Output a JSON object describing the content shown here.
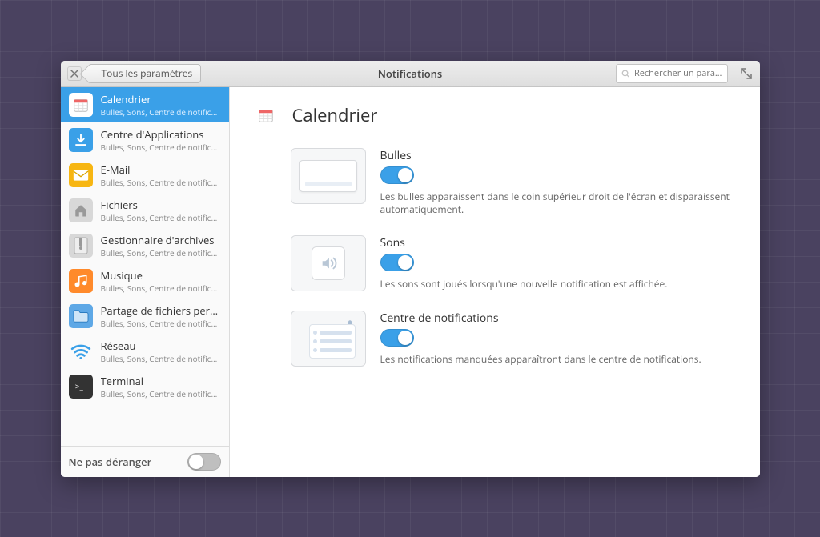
{
  "titlebar": {
    "breadcrumb": "Tous les paramètres",
    "title": "Notifications",
    "search_placeholder": "Rechercher un para…"
  },
  "sidebar": {
    "items": [
      {
        "title": "Calendrier",
        "sub": "Bulles, Sons, Centre de notifications",
        "icon": "calendar",
        "color": "#ffffff",
        "selected": true
      },
      {
        "title": "Centre d'Applications",
        "sub": "Bulles, Sons, Centre de notifications",
        "icon": "download",
        "color": "#3aa0e8"
      },
      {
        "title": "E-Mail",
        "sub": "Bulles, Sons, Centre de notifications",
        "icon": "mail",
        "color": "#f7b612"
      },
      {
        "title": "Fichiers",
        "sub": "Bulles, Sons, Centre de notifications",
        "icon": "home",
        "color": "#d8d8d8"
      },
      {
        "title": "Gestionnaire d'archives",
        "sub": "Bulles, Sons, Centre de notifications",
        "icon": "zip",
        "color": "#d8d8d8"
      },
      {
        "title": "Musique",
        "sub": "Bulles, Sons, Centre de notifications",
        "icon": "music",
        "color": "#ff8a2b"
      },
      {
        "title": "Partage de fichiers perso…",
        "sub": "Bulles, Sons, Centre de notifications",
        "icon": "folder",
        "color": "#5ea8e6"
      },
      {
        "title": "Réseau",
        "sub": "Bulles, Sons, Centre de notifications",
        "icon": "wifi",
        "color": "#3aa0e8"
      },
      {
        "title": "Terminal",
        "sub": "Bulles, Sons, Centre de notifications",
        "icon": "terminal",
        "color": "#333333"
      }
    ],
    "dnd_label": "Ne pas déranger",
    "dnd_on": false
  },
  "main": {
    "title": "Calendrier",
    "settings": [
      {
        "title": "Bulles",
        "desc": "Les bulles apparaissent dans le coin supérieur droit de l'écran et disparaissent automatiquement.",
        "on": true
      },
      {
        "title": "Sons",
        "desc": "Les sons sont joués lorsqu'une nouvelle notification est affichée.",
        "on": true
      },
      {
        "title": "Centre de notifications",
        "desc": "Les notifications manquées apparaîtront dans le centre de notifications.",
        "on": true
      }
    ]
  }
}
